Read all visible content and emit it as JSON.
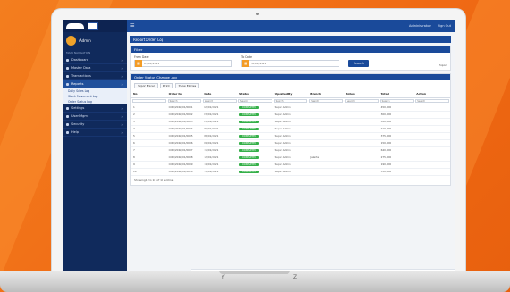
{
  "app": {
    "profile_name": "Admin",
    "nav_head": "MAIN NAVIGATION",
    "nav_items": [
      {
        "label": "Dashboard",
        "active": false
      },
      {
        "label": "Master Data",
        "active": false
      },
      {
        "label": "Transactions",
        "active": false
      },
      {
        "label": "Reports",
        "active": true
      },
      {
        "label": "Settings",
        "active": false
      },
      {
        "label": "User Mgmt",
        "active": false
      },
      {
        "label": "Security",
        "active": false
      },
      {
        "label": "Help",
        "active": false
      }
    ],
    "sub_items": [
      "Daily Sales Log",
      "Stock Movement Log",
      "Order Status Log"
    ],
    "topbar_right": [
      "Administrator",
      "Sign Out"
    ],
    "panel_title": "Report Order Log",
    "filter_card_title": "Filter",
    "filters": [
      {
        "label": "From Date",
        "value": "01/01/2021"
      },
      {
        "label": "To Date",
        "value": "31/01/2021"
      }
    ],
    "search_label": "Search",
    "filter_right": "Export",
    "list_card_title": "Order Status Change Log",
    "toolbar_buttons": [
      "Export Excel",
      "Print",
      "Show Entries"
    ],
    "columns": [
      "No",
      "Order No",
      "Date",
      "Status",
      "Updated By",
      "Branch",
      "Notes",
      "Total",
      "Action"
    ],
    "filter_cells": [
      "",
      "Search",
      "Search",
      "Search",
      "Search",
      "Search",
      "Search",
      "Search",
      "Search"
    ],
    "rows": [
      [
        "1",
        "ORD/2021/01/0001",
        "02/01/2021",
        "COMPLETED",
        "Super Admin",
        "",
        "",
        "450,000",
        ""
      ],
      [
        "2",
        "ORD/2021/01/0002",
        "03/01/2021",
        "COMPLETED",
        "Super Admin",
        "",
        "",
        "300,000",
        ""
      ],
      [
        "3",
        "ORD/2021/01/0003",
        "05/01/2021",
        "COMPLETED",
        "Super Admin",
        "",
        "",
        "520,000",
        ""
      ],
      [
        "4",
        "ORD/2021/01/0004",
        "06/01/2021",
        "COMPLETED",
        "Super Admin",
        "",
        "",
        "210,000",
        ""
      ],
      [
        "5",
        "ORD/2021/01/0005",
        "08/01/2021",
        "COMPLETED",
        "Super Admin",
        "",
        "",
        "375,000",
        ""
      ],
      [
        "6",
        "ORD/2021/01/0006",
        "09/01/2021",
        "COMPLETED",
        "Super Admin",
        "",
        "",
        "150,000",
        ""
      ],
      [
        "7",
        "ORD/2021/01/0007",
        "11/01/2021",
        "COMPLETED",
        "Super Admin",
        "",
        "",
        "640,000",
        ""
      ],
      [
        "8",
        "ORD/2021/01/0008",
        "12/01/2021",
        "COMPLETED",
        "Super Admin",
        "Jakarta",
        "",
        "275,000",
        ""
      ],
      [
        "9",
        "ORD/2021/01/0009",
        "14/01/2021",
        "COMPLETED",
        "Super Admin",
        "",
        "",
        "190,000",
        ""
      ],
      [
        "10",
        "ORD/2021/01/0010",
        "15/01/2021",
        "COMPLETED",
        "Super Admin",
        "",
        "",
        "330,000",
        ""
      ]
    ],
    "table_info": "Showing 1 to 10 of 10 entries",
    "footer": "Copyright © 2021 Order Tracker. All rights reserved."
  },
  "laptop": {
    "base_marks": [
      "Y",
      "Z"
    ]
  },
  "colors": {
    "accent": "#1a4a9a",
    "sidebar": "#102a5c",
    "status": "#36b04a",
    "background": "#f37e1f"
  }
}
